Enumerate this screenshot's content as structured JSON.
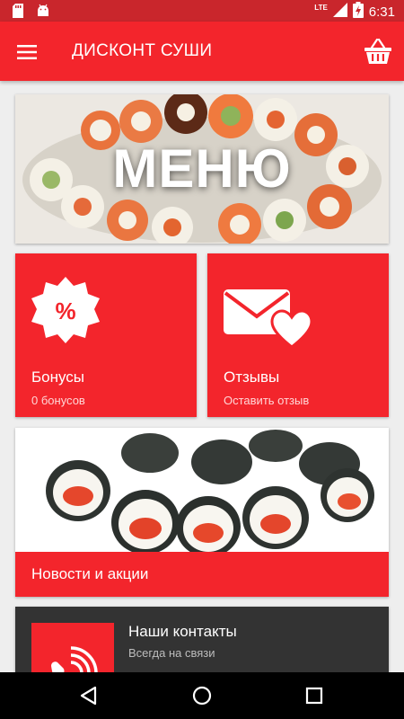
{
  "status_bar": {
    "time": "6:31",
    "network": "LTE",
    "icons": [
      "sd-card-icon",
      "android-icon",
      "signal-icon",
      "battery-icon"
    ]
  },
  "app_bar": {
    "title": "ДИСКОНТ СУШИ",
    "icons": [
      "hamburger-menu-icon",
      "shopping-basket-icon"
    ]
  },
  "menu_banner": {
    "label": "МЕНЮ"
  },
  "tiles": [
    {
      "title": "Бонусы",
      "subtitle": "0 бонусов",
      "icon": "percent-badge-icon"
    },
    {
      "title": "Отзывы",
      "subtitle": "Оставить отзыв",
      "icon": "envelope-heart-icon"
    }
  ],
  "news": {
    "label": "Новости и акции"
  },
  "contacts": {
    "title": "Наши контакты",
    "subtitle": "Всегда на связи",
    "icon": "phone-ringing-icon"
  },
  "nav_bar": {
    "icons": [
      "back-icon",
      "home-icon",
      "recents-icon"
    ]
  },
  "colors": {
    "accent": "#f3252c",
    "status_bar": "#c9262c",
    "contacts_bg": "#333333",
    "background": "#eeeeee"
  }
}
